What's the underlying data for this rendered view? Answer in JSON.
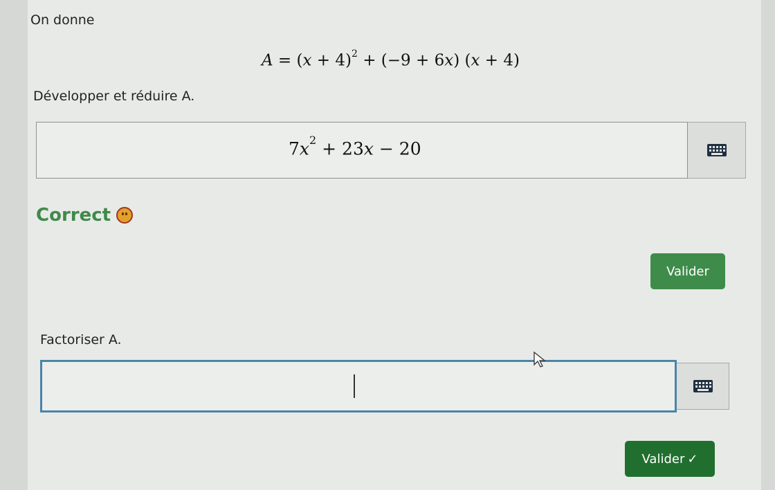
{
  "intro": "On donne",
  "formula": {
    "lhs": "A",
    "eq": " = (",
    "x1": "x",
    "p1": " + 4)",
    "exp": "2",
    "p2": " + (−9 + 6",
    "x2": "x",
    "p3": ") (",
    "x3": "x",
    "p4": " + 4)"
  },
  "q1": {
    "prompt": "Développer et réduire A.",
    "answer": {
      "coef": "7",
      "var": "x",
      "exp": "2",
      "mid": " + 23",
      "var2": "x",
      "tail": " − 20"
    },
    "status": "Correct",
    "button": "Valider"
  },
  "q2": {
    "prompt": "Factoriser A.",
    "button": "Valider",
    "button_check": "✓"
  },
  "icons": {
    "keyboard": "keyboard-icon",
    "smiley": "smiley-icon",
    "cursor": "mouse-pointer-icon"
  },
  "colors": {
    "success": "#3f8a49",
    "button": "#2e7d3b",
    "focus_border": "#4a84a8"
  }
}
